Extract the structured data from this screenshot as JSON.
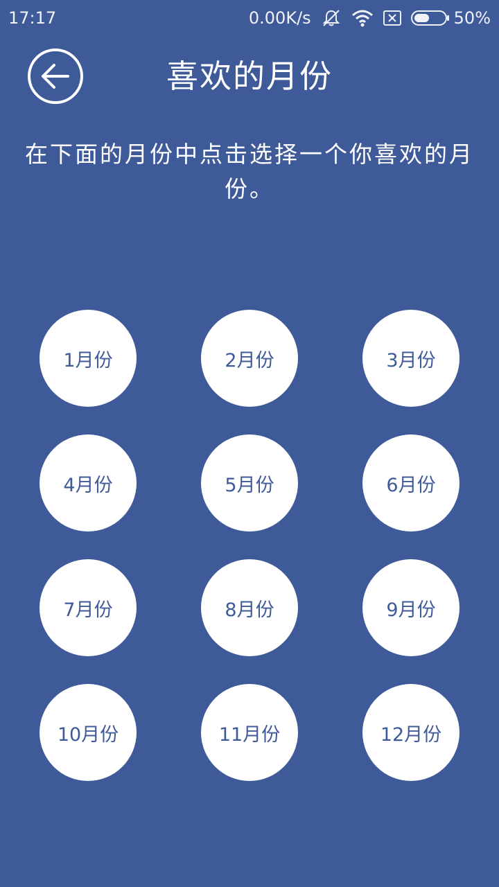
{
  "status_bar": {
    "time": "17:17",
    "network_speed": "0.00K/s",
    "battery_percent": "50%",
    "battery_level": 0.5,
    "icons": [
      "mute-vibrate-icon",
      "wifi-icon",
      "sim-card-icon",
      "battery-icon"
    ]
  },
  "header": {
    "title": "喜欢的月份",
    "back_icon": "back-arrow-icon"
  },
  "instruction": "在下面的月份中点击选择一个你喜欢的月份。",
  "months": [
    {
      "label": "1月份"
    },
    {
      "label": "2月份"
    },
    {
      "label": "3月份"
    },
    {
      "label": "4月份"
    },
    {
      "label": "5月份"
    },
    {
      "label": "6月份"
    },
    {
      "label": "7月份"
    },
    {
      "label": "8月份"
    },
    {
      "label": "9月份"
    },
    {
      "label": "10月份"
    },
    {
      "label": "11月份"
    },
    {
      "label": "12月份"
    }
  ],
  "colors": {
    "background": "#3F5A99",
    "button": "#FFFFFF",
    "button_text": "#3F5A99"
  }
}
